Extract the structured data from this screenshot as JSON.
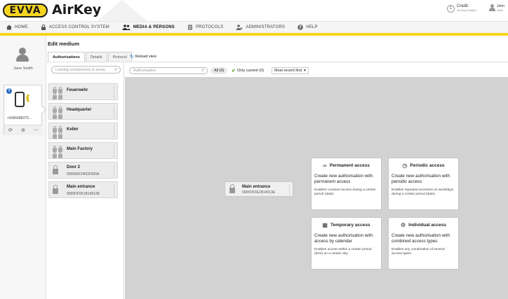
{
  "header": {
    "brand": "EVVA",
    "app_name": "AirKey",
    "credit_label": "Credit",
    "credit_sub": "48 KeyCredit(s)",
    "credit_badge": "1",
    "user_name": "John",
    "user_role": "Admi"
  },
  "nav": [
    {
      "label": "HOME",
      "icon": "home-icon"
    },
    {
      "label": "ACCESS CONTROL SYSTEM",
      "icon": "lock-icon"
    },
    {
      "label": "MEDIA & PERSONS",
      "icon": "persons-icon"
    },
    {
      "label": "PROTOCOLS",
      "icon": "document-icon"
    },
    {
      "label": "ADMINISTRATORS",
      "icon": "admin-icon"
    },
    {
      "label": "HELP",
      "icon": "help-icon"
    }
  ],
  "person": {
    "name": "Jane Smith",
    "medium_id": "+4366488370...",
    "actions": [
      "⟳",
      "⊘",
      "⋯"
    ]
  },
  "edit": {
    "title": "Edit medium",
    "tabs": [
      "Authorisations",
      "Details",
      "Protocol"
    ],
    "reload": "Reload view",
    "search_placeholder": "Locking components & areas"
  },
  "components": [
    {
      "name": "Feuerwehr",
      "sub": "",
      "kind": "area"
    },
    {
      "name": "Headquarter",
      "sub": "",
      "kind": "area"
    },
    {
      "name": "Keller",
      "sub": "",
      "kind": "area"
    },
    {
      "name": "Main Factory",
      "sub": "",
      "kind": "area"
    },
    {
      "name": "Door 2",
      "sub": "000565F246DF929A",
      "kind": "lock"
    },
    {
      "name": "Main entrance",
      "sub": "0005DF0E1B14013E",
      "kind": "lock"
    }
  ],
  "filter": {
    "search_placeholder": "Authorisation",
    "all_chip": "All (0)",
    "only_current": "Only current (0)",
    "sort": "Most recent first"
  },
  "canvas_component": {
    "name": "Main entrance",
    "sub": "0005DF0E1B14013E"
  },
  "access_cards": [
    {
      "title": "Permanent access",
      "icon": "infinity-icon",
      "desc": "Create new authorisation with permanent access",
      "note": "Enables constant access during a certain period (date)."
    },
    {
      "title": "Periodic access",
      "icon": "clock-icon",
      "desc": "Create new authorisation with periodic access",
      "note": "Enables repeated accesses on weekdays during a certain period (date)."
    },
    {
      "title": "Temporary access",
      "icon": "calendar-icon",
      "desc": "Create new authorisation with access by calendar",
      "note": "Enables access within a certain period (time) on a certain day."
    },
    {
      "title": "Individual access",
      "icon": "gear-icon",
      "desc": "Create new authorisation with combined access types",
      "note": "Enables any combination of several access types."
    }
  ]
}
